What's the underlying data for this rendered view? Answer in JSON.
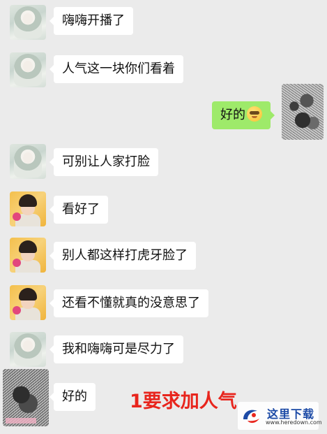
{
  "messages": [
    {
      "side": "left",
      "avatar": "girl-avatar",
      "text": "嗨嗨开播了"
    },
    {
      "side": "left",
      "avatar": "girl-avatar",
      "text": "人气这一块你们看着"
    },
    {
      "side": "right",
      "avatar": "scribbled-avatar",
      "text": "好的",
      "emoji": "sunglasses-smug-emoji"
    },
    {
      "side": "left",
      "avatar": "girl-avatar",
      "text": "可别让人家打脸"
    },
    {
      "side": "left",
      "avatar": "boy-avatar",
      "text": "看好了"
    },
    {
      "side": "left",
      "avatar": "boy-avatar",
      "text": "别人都这样打虎牙脸了"
    },
    {
      "side": "left",
      "avatar": "boy-avatar",
      "text": "还看不懂就真的没意思了"
    },
    {
      "side": "left",
      "avatar": "girl-avatar",
      "text": "我和嗨嗨可是尽力了"
    },
    {
      "side": "left",
      "avatar": "scribbled-avatar",
      "text": "好的"
    }
  ],
  "overlay": {
    "text": "1要求加人气"
  },
  "watermark": {
    "title": "这里下载",
    "url": "www.heredown.com"
  },
  "colors": {
    "background": "#ebebeb",
    "bubble_in": "#ffffff",
    "bubble_out": "#9eea6a",
    "overlay": "#e8251d",
    "watermark_blue": "#1c4aa6"
  }
}
